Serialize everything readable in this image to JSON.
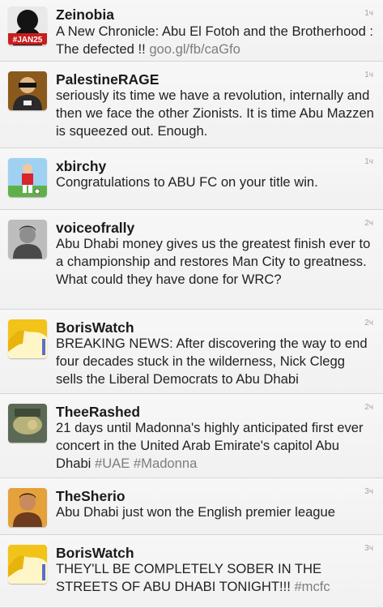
{
  "tweets": [
    {
      "name": "Zeinobia",
      "text": "A New Chronicle: Abu El Fotoh and the Brotherhood : The defected !! ",
      "link": "goo.gl/fb/caGfo",
      "time": "1ч",
      "avatar": "jan25-silhouette-avatar"
    },
    {
      "name": "PalestineRAGE",
      "text": "seriously its time we have a revolution, internally and then we face the other Zionists. It is time Abu Mazzen is squeezed out. Enough.",
      "link": "",
      "time": "1ч",
      "avatar": "masked-man-avatar"
    },
    {
      "name": "xbirchy",
      "text": "Congratulations to ABU FC on your title win.",
      "link": "",
      "time": "1ч",
      "avatar": "cartoon-footballer-avatar"
    },
    {
      "name": "voiceofrally",
      "text": "Abu Dhabi money gives us the greatest finish ever to a championship and restores Man City to greatness. What could they have done for WRC?",
      "link": "",
      "time": "2ч",
      "avatar": "man-portrait-avatar"
    },
    {
      "name": "BorisWatch",
      "text": "BREAKING NEWS: After discovering the way to end four decades stuck in the wilderness, Nick Clegg sells the Liberal Democrats to Abu Dhabi",
      "link": "",
      "time": "2ч",
      "avatar": "blond-hair-avatar"
    },
    {
      "name": "TheeRashed",
      "text": "21 days until Madonna's highly anticipated first ever concert in the United Arab Emirate's capitol Abu Dhabi ",
      "link": "#UAE #Madonna",
      "time": "2ч",
      "avatar": "photo-avatar"
    },
    {
      "name": "TheSherio",
      "text": "Abu Dhabi just won the English premier league",
      "link": "",
      "time": "3ч",
      "avatar": "man-portrait-avatar"
    },
    {
      "name": "BorisWatch",
      "text": "THEY'LL BE COMPLETELY SOBER IN THE STREETS OF ABU DHABI TONIGHT!!! ",
      "link": "#mcfc",
      "time": "3ч",
      "avatar": "blond-hair-avatar"
    }
  ]
}
